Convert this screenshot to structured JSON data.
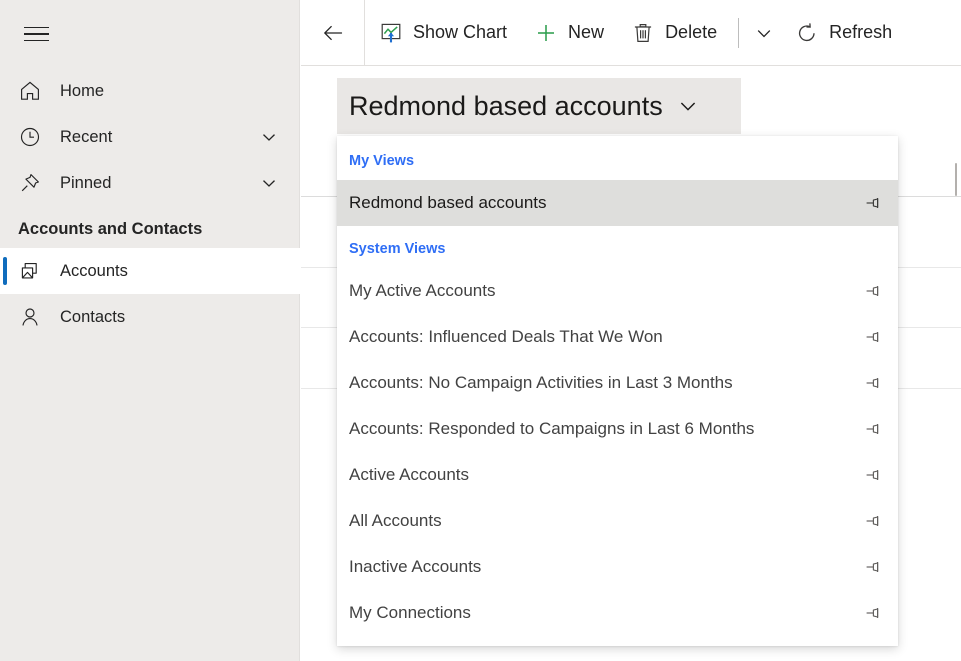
{
  "sidebar": {
    "menu_icon": "hamburger-icon",
    "items": [
      {
        "label": "Home",
        "icon": "home-icon",
        "expandable": false
      },
      {
        "label": "Recent",
        "icon": "clock-icon",
        "expandable": true
      },
      {
        "label": "Pinned",
        "icon": "pin-icon",
        "expandable": true
      }
    ],
    "group_header": "Accounts and Contacts",
    "group_items": [
      {
        "label": "Accounts",
        "icon": "accounts-icon",
        "selected": true
      },
      {
        "label": "Contacts",
        "icon": "person-icon",
        "selected": false
      }
    ],
    "selection_color": "#0f6cbd",
    "background_color": "#edebe9"
  },
  "toolbar": {
    "back_icon": "arrow-left-icon",
    "buttons": [
      {
        "label": "Show Chart",
        "icon": "show-chart-icon"
      },
      {
        "label": "New",
        "icon": "plus-icon"
      },
      {
        "label": "Delete",
        "icon": "trash-icon"
      }
    ],
    "overflow_icon": "chevron-down-icon",
    "refresh": {
      "label": "Refresh",
      "icon": "refresh-icon"
    }
  },
  "view_selector": {
    "current_view": "Redmond based accounts",
    "chevron_icon": "chevron-down-icon",
    "expanded": true
  },
  "view_dropdown": {
    "sections": [
      {
        "title": "My Views",
        "title_color": "#2f6ef5",
        "items": [
          {
            "label": "Redmond based accounts",
            "pin_icon": "pin-icon",
            "current": true
          }
        ]
      },
      {
        "title": "System Views",
        "title_color": "#2f6ef5",
        "items": [
          {
            "label": "My Active Accounts",
            "pin_icon": "pin-icon",
            "current": false
          },
          {
            "label": "Accounts: Influenced Deals That We Won",
            "pin_icon": "pin-icon",
            "current": false
          },
          {
            "label": "Accounts: No Campaign Activities in Last 3 Months",
            "pin_icon": "pin-icon",
            "current": false
          },
          {
            "label": "Accounts: Responded to Campaigns in Last 6 Months",
            "pin_icon": "pin-icon",
            "current": false
          },
          {
            "label": "Active Accounts",
            "pin_icon": "pin-icon",
            "current": false
          },
          {
            "label": "All Accounts",
            "pin_icon": "pin-icon",
            "current": false
          },
          {
            "label": "Inactive Accounts",
            "pin_icon": "pin-icon",
            "current": false
          },
          {
            "label": "My Connections",
            "pin_icon": "pin-icon",
            "current": false
          }
        ]
      }
    ]
  }
}
